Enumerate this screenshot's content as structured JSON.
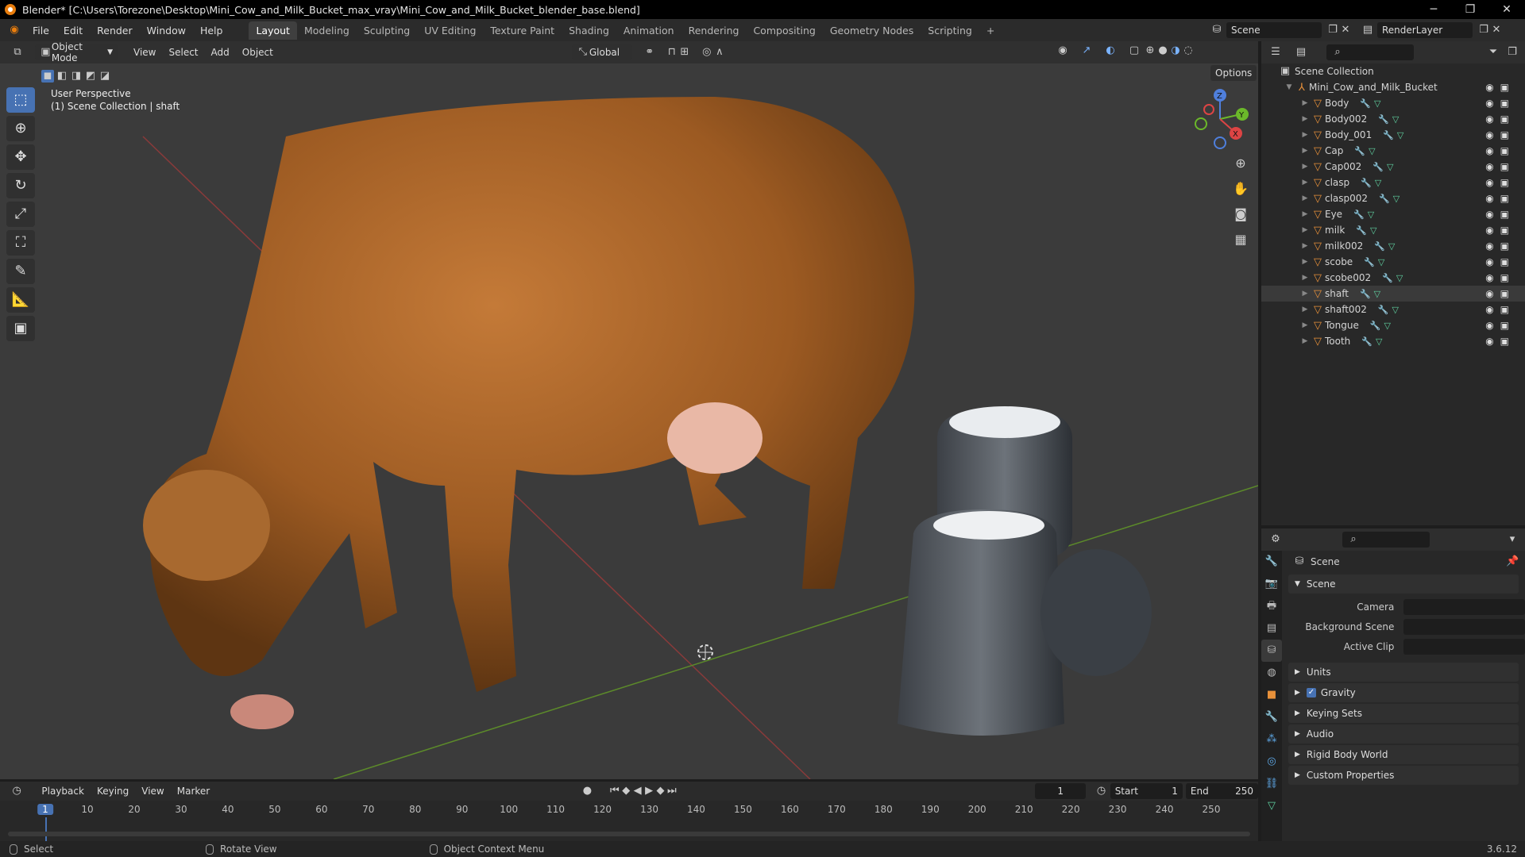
{
  "window": {
    "title": "Blender* [C:\\Users\\Torezone\\Desktop\\Mini_Cow_and_Milk_Bucket_max_vray\\Mini_Cow_and_Milk_Bucket_blender_base.blend]",
    "min": "─",
    "max": "❐",
    "close": "✕"
  },
  "menus": [
    "File",
    "Edit",
    "Render",
    "Window",
    "Help"
  ],
  "workspaces": [
    "Layout",
    "Modeling",
    "Sculpting",
    "UV Editing",
    "Texture Paint",
    "Shading",
    "Animation",
    "Rendering",
    "Compositing",
    "Geometry Nodes",
    "Scripting"
  ],
  "scene_name": "Scene",
  "view_layer": "RenderLayer",
  "viewport": {
    "mode": "Object Mode",
    "menu": [
      "View",
      "Select",
      "Add",
      "Object"
    ],
    "orientation": "Global",
    "options": "Options",
    "overlay_line1": "User Perspective",
    "overlay_line2": "(1) Scene Collection | shaft",
    "axis": {
      "x": "X",
      "y": "Y",
      "z": "Z"
    }
  },
  "outliner": {
    "root": "Scene Collection",
    "collection": "Mini_Cow_and_Milk_Bucket",
    "items": [
      "Body",
      "Body002",
      "Body_001",
      "Cap",
      "Cap002",
      "clasp",
      "clasp002",
      "Eye",
      "milk",
      "milk002",
      "scobe",
      "scobe002",
      "shaft",
      "shaft002",
      "Tongue",
      "Tooth"
    ],
    "selected": "shaft"
  },
  "properties": {
    "context": "Scene",
    "section": "Scene",
    "rows": [
      "Camera",
      "Background Scene",
      "Active Clip"
    ],
    "panels": [
      "Units",
      "Gravity",
      "Keying Sets",
      "Audio",
      "Rigid Body World",
      "Custom Properties"
    ],
    "gravity_checked": true
  },
  "timeline": {
    "menus": [
      "Playback",
      "Keying",
      "View",
      "Marker"
    ],
    "current_frame": "1",
    "start_label": "Start",
    "start": "1",
    "end_label": "End",
    "end": "250",
    "ticks": [
      "1",
      "10",
      "20",
      "30",
      "40",
      "50",
      "60",
      "70",
      "80",
      "90",
      "100",
      "110",
      "120",
      "130",
      "140",
      "150",
      "160",
      "170",
      "180",
      "190",
      "200",
      "210",
      "220",
      "230",
      "240",
      "250"
    ]
  },
  "status": {
    "hint1": "Select",
    "hint2": "Rotate View",
    "hint3": "Object Context Menu",
    "version": "3.6.12"
  },
  "colors": {
    "accent": "#4772b3",
    "object": "#e8913a",
    "bg": "#3b3b3b"
  }
}
